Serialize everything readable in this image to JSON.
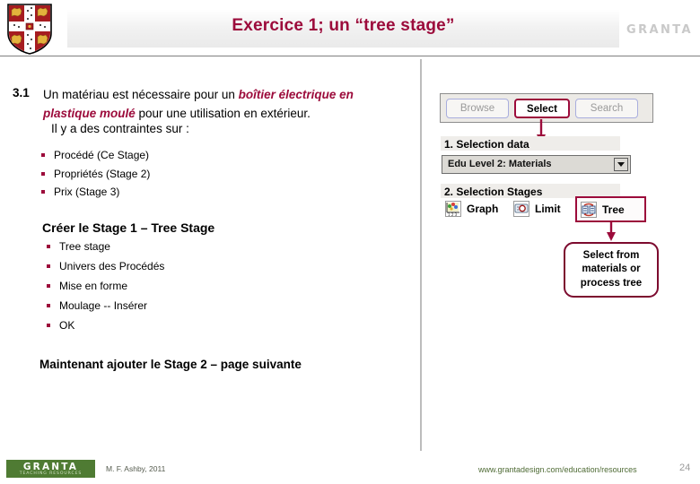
{
  "header": {
    "title": "Exercice 1; un “tree stage”",
    "brand": "GRANTA",
    "crest_name": "university-of-cambridge-coat-of-arms"
  },
  "content": {
    "question_number": "3.1",
    "question_part1": "Un matériau est nécessaire pour un ",
    "question_highlight1": "boîtier électrique en plastique moulé",
    "question_part2": " pour une utilisation en extérieur.",
    "question_line3": "Il y a des contraintes sur :",
    "constraints": [
      "Procédé (Ce Stage)",
      "Propriétés (Stage 2)",
      "Prix (Stage 3)"
    ],
    "stage1_heading": "Créer le Stage 1 – Tree Stage",
    "stage1_steps": [
      "Tree stage",
      "Univers des Procédés",
      "Mise en forme",
      "Moulage -- Insérer",
      "OK"
    ],
    "next_note": "Maintenant ajouter le Stage 2 – page suivante"
  },
  "app": {
    "tabs": [
      {
        "label": "Browse",
        "state": "inactive"
      },
      {
        "label": "Select",
        "state": "active"
      },
      {
        "label": "Search",
        "state": "inactive"
      }
    ],
    "selection_data_label": "1. Selection data",
    "combo_value": "Edu Level 2: Materials",
    "combo_icon": "chevron-down-icon",
    "selection_stages_label": "2. Selection Stages",
    "stage_buttons": [
      {
        "label": "Graph",
        "icon": "graph-icon",
        "state": "normal"
      },
      {
        "label": "Limit",
        "icon": "limit-icon",
        "state": "normal"
      },
      {
        "label": "Tree",
        "icon": "tree-icon",
        "state": "highlighted"
      }
    ],
    "callout": "Select from materials or process tree"
  },
  "footer": {
    "brand": "GRANTA",
    "brand_sub": "TEACHING RESOURCES",
    "credit": "M. F. Ashby, 2011",
    "url": "www.grantadesign.com/education/resources",
    "page_number": "24"
  },
  "colors": {
    "accent_red": "#9c0b3b",
    "callout_border": "#7c0a2e",
    "footer_green": "#4f7b33",
    "tab_inactive_border": "#a9aede"
  }
}
